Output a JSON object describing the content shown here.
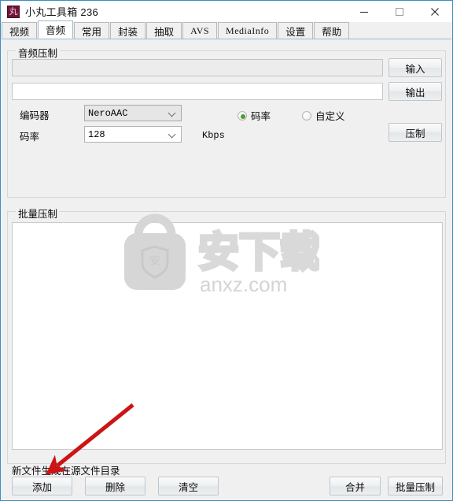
{
  "window": {
    "title": "小丸工具箱 236",
    "icon_glyph": "丸",
    "icon_color": "#6e1437",
    "minimize_label": "minimize",
    "maximize_label": "maximize",
    "close_label": "close"
  },
  "tabs": [
    {
      "label": "视频",
      "active": false
    },
    {
      "label": "音频",
      "active": true
    },
    {
      "label": "常用",
      "active": false
    },
    {
      "label": "封装",
      "active": false
    },
    {
      "label": "抽取",
      "active": false
    },
    {
      "label": "AVS",
      "active": false
    },
    {
      "label": "MediaInfo",
      "active": false
    },
    {
      "label": "设置",
      "active": false
    },
    {
      "label": "帮助",
      "active": false
    }
  ],
  "audio_encode": {
    "legend": "音频压制",
    "input_path": "",
    "input_placeholder": "",
    "output_path": "",
    "output_placeholder": "",
    "input_button": "输入",
    "output_button": "输出",
    "encode_button": "压制",
    "encoder_label": "编码器",
    "encoder_value": "NeroAAC",
    "bitrate_label": "码率",
    "bitrate_value": "128",
    "bitrate_unit": "Kbps",
    "mode_bitrate": "码率",
    "mode_custom": "自定义",
    "mode_selected": "码率"
  },
  "batch_encode": {
    "legend": "批量压制",
    "list_items": [],
    "note": "新文件生成在源文件目录",
    "add_button": "添加",
    "delete_button": "删除",
    "clear_button": "清空",
    "merge_button": "合并",
    "batch_button": "批量压制"
  },
  "watermark": {
    "text_cn": "安下载",
    "text_url": "anxz.com",
    "badge_glyph": "安",
    "color": "#d4d4d4"
  },
  "annotation": {
    "arrow_color": "#cc1414",
    "points_to": "添加"
  }
}
